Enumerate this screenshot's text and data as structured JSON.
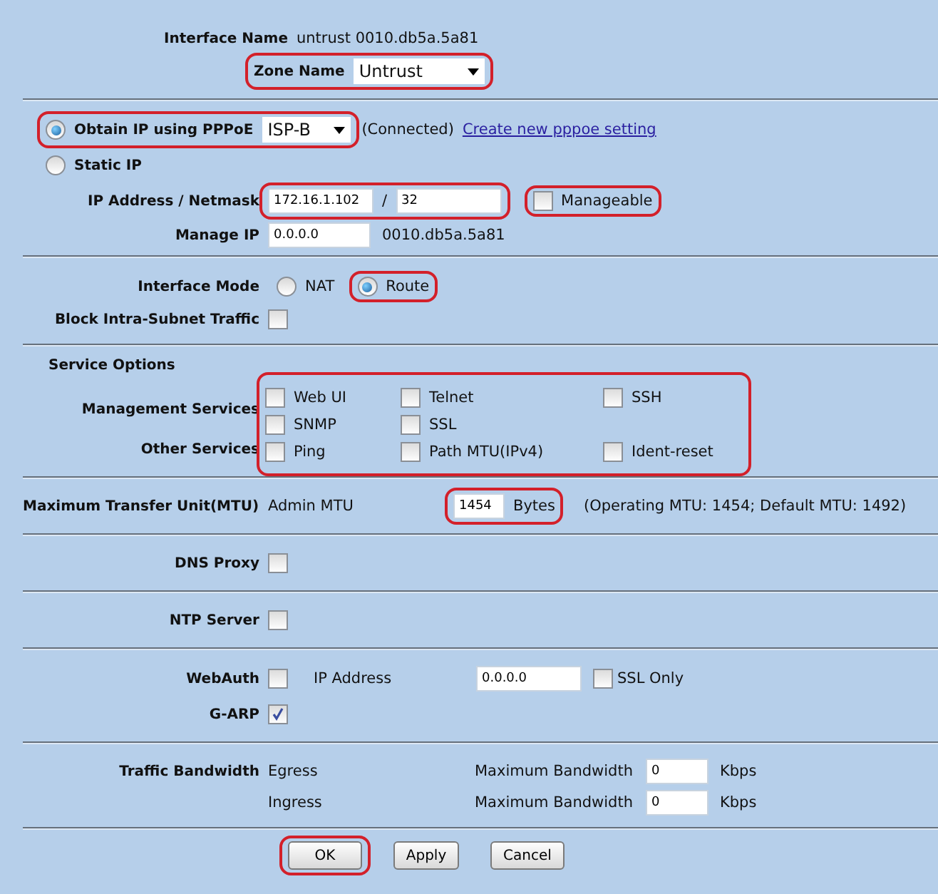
{
  "interface": {
    "name_label": "Interface Name",
    "name_value": "untrust 0010.db5a.5a81",
    "zone_label": "Zone Name",
    "zone_value": "Untrust",
    "zone_highlighted": true
  },
  "addressing": {
    "options": [
      {
        "kind": "pppoe",
        "label": "Obtain IP using PPPoE",
        "selected": true,
        "highlighted": true,
        "select_value": "ISP-B",
        "status": "(Connected)",
        "link": "Create new pppoe setting"
      },
      {
        "kind": "static",
        "label": "Static IP",
        "selected": false
      }
    ],
    "ip_label": "IP Address / Netmask",
    "ip": "172.16.1.102",
    "separator": "/",
    "netmask": "32",
    "ip_highlighted": true,
    "manageable": {
      "label": "Manageable",
      "checked": false,
      "highlighted": true
    },
    "manage_ip_label": "Manage IP",
    "manage_ip": "0.0.0.0",
    "manage_mac": "0010.db5a.5a81"
  },
  "mode": {
    "label": "Interface Mode",
    "options": [
      {
        "label": "NAT",
        "selected": false,
        "highlighted": false
      },
      {
        "label": "Route",
        "selected": true,
        "highlighted": true
      }
    ],
    "block": {
      "label": "Block Intra-Subnet Traffic",
      "checked": false
    }
  },
  "services": {
    "title": "Service Options",
    "highlighted": true,
    "groups": [
      {
        "label": "Management Services",
        "rows": [
          [
            {
              "label": "Web UI",
              "checked": false
            },
            {
              "label": "Telnet",
              "checked": false
            },
            {
              "label": "SSH",
              "checked": false
            }
          ],
          [
            {
              "label": "SNMP",
              "checked": false
            },
            {
              "label": "SSL",
              "checked": false
            }
          ]
        ]
      },
      {
        "label": "Other Services",
        "rows": [
          [
            {
              "label": "Ping",
              "checked": false
            },
            {
              "label": "Path MTU(IPv4)",
              "checked": false
            },
            {
              "label": "Ident-reset",
              "checked": false
            }
          ]
        ]
      }
    ]
  },
  "mtu": {
    "label": "Maximum Transfer Unit(MTU)",
    "sublabel": "Admin MTU",
    "value": "1454",
    "unit": "Bytes",
    "highlighted": true,
    "info": "(Operating MTU: 1454; Default MTU: 1492)"
  },
  "dns_proxy": {
    "label": "DNS Proxy",
    "checked": false
  },
  "ntp_server": {
    "label": "NTP Server",
    "checked": false
  },
  "webauth": {
    "label": "WebAuth",
    "checked": false,
    "ip_label": "IP Address",
    "ip": "0.0.0.0",
    "ssl_only": {
      "label": "SSL Only",
      "checked": false
    }
  },
  "garp": {
    "label": "G-ARP",
    "checked": true
  },
  "bandwidth": {
    "label": "Traffic Bandwidth",
    "rows": [
      {
        "direction": "Egress",
        "field_label": "Maximum Bandwidth",
        "value": "0",
        "unit": "Kbps"
      },
      {
        "direction": "Ingress",
        "field_label": "Maximum Bandwidth",
        "value": "0",
        "unit": "Kbps"
      }
    ]
  },
  "buttons": [
    {
      "label": "OK",
      "highlighted": true
    },
    {
      "label": "Apply",
      "highlighted": false
    },
    {
      "label": "Cancel",
      "highlighted": false
    }
  ]
}
